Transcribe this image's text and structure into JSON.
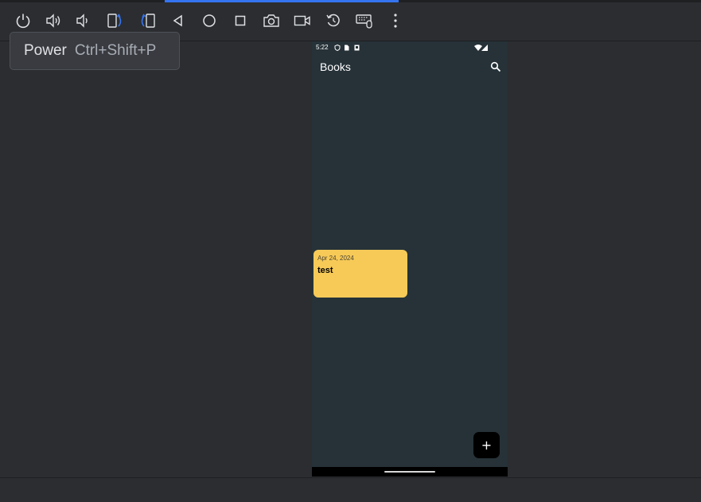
{
  "toolbar": {
    "buttons": [
      {
        "icon": "power-icon"
      },
      {
        "icon": "volume-up-icon"
      },
      {
        "icon": "volume-down-icon"
      },
      {
        "icon": "rotate-left-icon"
      },
      {
        "icon": "rotate-right-icon"
      },
      {
        "icon": "back-icon"
      },
      {
        "icon": "home-icon"
      },
      {
        "icon": "overview-icon"
      },
      {
        "icon": "camera-icon"
      },
      {
        "icon": "video-record-icon"
      },
      {
        "icon": "reset-icon"
      },
      {
        "icon": "keyboard-mouse-icon"
      },
      {
        "icon": "more-vert-icon"
      }
    ],
    "accent_color": "#3574f0"
  },
  "tooltip": {
    "title": "Power",
    "shortcut": "Ctrl+Shift+P"
  },
  "device": {
    "status_bar": {
      "time": "5:22"
    },
    "app_bar": {
      "title": "Books"
    },
    "notes": [
      {
        "date": "Apr 24, 2024",
        "title": "test",
        "color": "#f7ca57"
      }
    ],
    "fab": {
      "label": "+"
    },
    "background_color": "#263238"
  }
}
